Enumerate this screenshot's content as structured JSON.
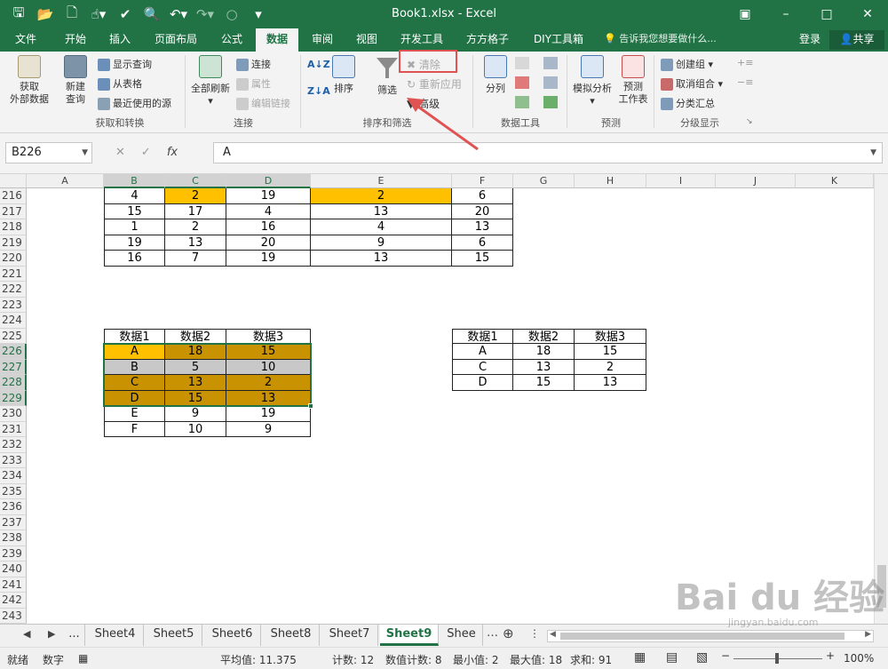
{
  "window": {
    "title": "Book1.xlsx - Excel"
  },
  "tabs": [
    "文件",
    "开始",
    "插入",
    "页面布局",
    "公式",
    "数据",
    "审阅",
    "视图",
    "开发工具",
    "方方格子",
    "DIY工具箱"
  ],
  "active_tab": "数据",
  "tell_me": "告诉我您想要做什么...",
  "login": "登录",
  "share": "共享",
  "ribbon": {
    "get_external": "获取\n外部数据",
    "new_query": "新建\n查询",
    "show_query": "显示查询",
    "from_table": "从表格",
    "recent_sources": "最近使用的源",
    "group_get_transform": "获取和转换",
    "refresh_all": "全部刷新",
    "connections": "连接",
    "properties": "属性",
    "edit_links": "编辑链接",
    "group_connections": "连接",
    "sort": "排序",
    "filter": "筛选",
    "clear": "清除",
    "reapply": "重新应用",
    "advanced": "高级",
    "group_sort_filter": "排序和筛选",
    "text_to_columns": "分列",
    "group_data_tools": "数据工具",
    "what_if": "模拟分析",
    "forecast_sheet": "预测\n工作表",
    "group_forecast": "预测",
    "group": "创建组",
    "ungroup": "取消组合",
    "subtotal": "分类汇总",
    "group_outline": "分级显示"
  },
  "formula_bar": {
    "name_box": "B226",
    "formula": "A"
  },
  "columns": [
    "A",
    "B",
    "C",
    "D",
    "E",
    "F",
    "G",
    "H",
    "I",
    "J",
    "K"
  ],
  "rows": [
    "216",
    "217",
    "218",
    "219",
    "220",
    "221",
    "222",
    "223",
    "224",
    "225",
    "226",
    "227",
    "228",
    "229",
    "230",
    "231",
    "232",
    "233",
    "234",
    "235",
    "236",
    "237",
    "238",
    "239",
    "240",
    "241",
    "242",
    "243"
  ],
  "table_top": [
    [
      "4",
      "2",
      "19",
      "2",
      "6"
    ],
    [
      "15",
      "17",
      "4",
      "13",
      "20"
    ],
    [
      "1",
      "2",
      "16",
      "4",
      "13"
    ],
    [
      "19",
      "13",
      "20",
      "9",
      "6"
    ],
    [
      "16",
      "7",
      "19",
      "13",
      "15"
    ]
  ],
  "table_left": {
    "headers": [
      "数据1",
      "数据2",
      "数据3"
    ],
    "rows": [
      [
        "A",
        "18",
        "15"
      ],
      [
        "B",
        "5",
        "10"
      ],
      [
        "C",
        "13",
        "2"
      ],
      [
        "D",
        "15",
        "13"
      ],
      [
        "E",
        "9",
        "19"
      ],
      [
        "F",
        "10",
        "9"
      ]
    ]
  },
  "table_right": {
    "headers": [
      "数据1",
      "数据2",
      "数据3"
    ],
    "rows": [
      [
        "A",
        "18",
        "15"
      ],
      [
        "C",
        "13",
        "2"
      ],
      [
        "D",
        "15",
        "13"
      ]
    ]
  },
  "colors": {
    "excel_green": "#217346",
    "highlight_orange": "#ffc000",
    "filter_brown": "#c99200",
    "filter_gray": "#c8c8c8",
    "annotation_red": "#e05353"
  },
  "sheets": [
    "...",
    "Sheet4",
    "Sheet5",
    "Sheet6",
    "Sheet8",
    "Sheet7",
    "Sheet9",
    "Shee"
  ],
  "active_sheet": "Sheet9",
  "status": {
    "ready": "就绪",
    "num": "数字",
    "average": "平均值: 11.375",
    "count": "计数: 12",
    "numeric_count": "数值计数: 8",
    "min": "最小值: 2",
    "max": "最大值: 18",
    "sum": "求和: 91",
    "zoom": "100%"
  },
  "watermark": {
    "brand": "Bai du 经验",
    "url": "jingyan.baidu.com"
  }
}
